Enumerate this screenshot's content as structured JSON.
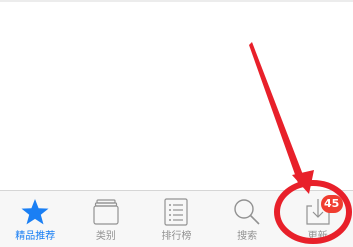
{
  "tabbar": {
    "tabs": [
      {
        "label": "精品推荐",
        "icon": "star-icon",
        "active": true
      },
      {
        "label": "类别",
        "icon": "stacked-squares-icon",
        "active": false
      },
      {
        "label": "排行榜",
        "icon": "list-icon",
        "active": false
      },
      {
        "label": "搜索",
        "icon": "search-icon",
        "active": false
      },
      {
        "label": "更新",
        "icon": "download-tray-icon",
        "active": false,
        "badge": "45"
      }
    ]
  },
  "annotation": {
    "arrow_color": "#e8202a",
    "circle_color": "#e8202a"
  },
  "colors": {
    "active": "#1a7ff4",
    "inactive": "#929292",
    "badge": "#f03d30"
  }
}
